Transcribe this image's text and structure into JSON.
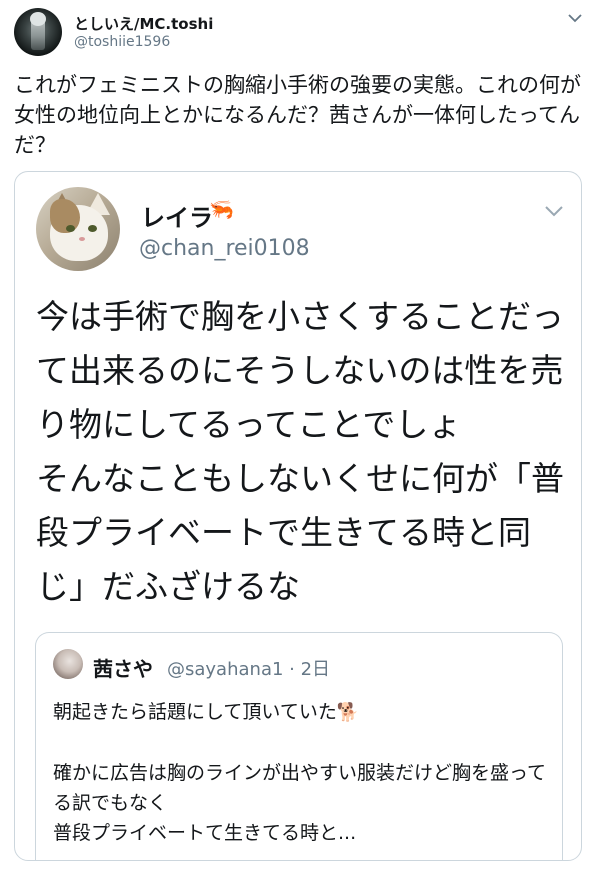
{
  "outer_tweet": {
    "display_name": "としいえ/MC.toshi",
    "handle": "@toshiie1596",
    "text": "これがフェミニストの胸縮小手術の強要の実態。これの何が女性の地位向上とかになるんだ？茜さんが一体何したってんだ？"
  },
  "quoted_tweet": {
    "display_name": "レイラ",
    "name_emoji": "🦐",
    "handle": "@chan_rei0108",
    "text": "今は手術で胸を小さくすることだって出来るのにそうしないのは性を売り物にしてるってことでしょ\nそんなこともしないくせに何が「普段プライベートで生きてる時と同じ」だふざけるな"
  },
  "nested_quote": {
    "display_name": "茜さや",
    "handle_time": "@sayahana1 · 2日",
    "line1": "朝起きたら話題にして頂いていた",
    "line1_emoji": "🐕",
    "body": "確かに広告は胸のラインが出やすい服装だけど胸を盛ってる訳でもなく\n普段プライベートて生きてる時と..."
  },
  "icons": {
    "menu": "chevron-down-icon"
  }
}
